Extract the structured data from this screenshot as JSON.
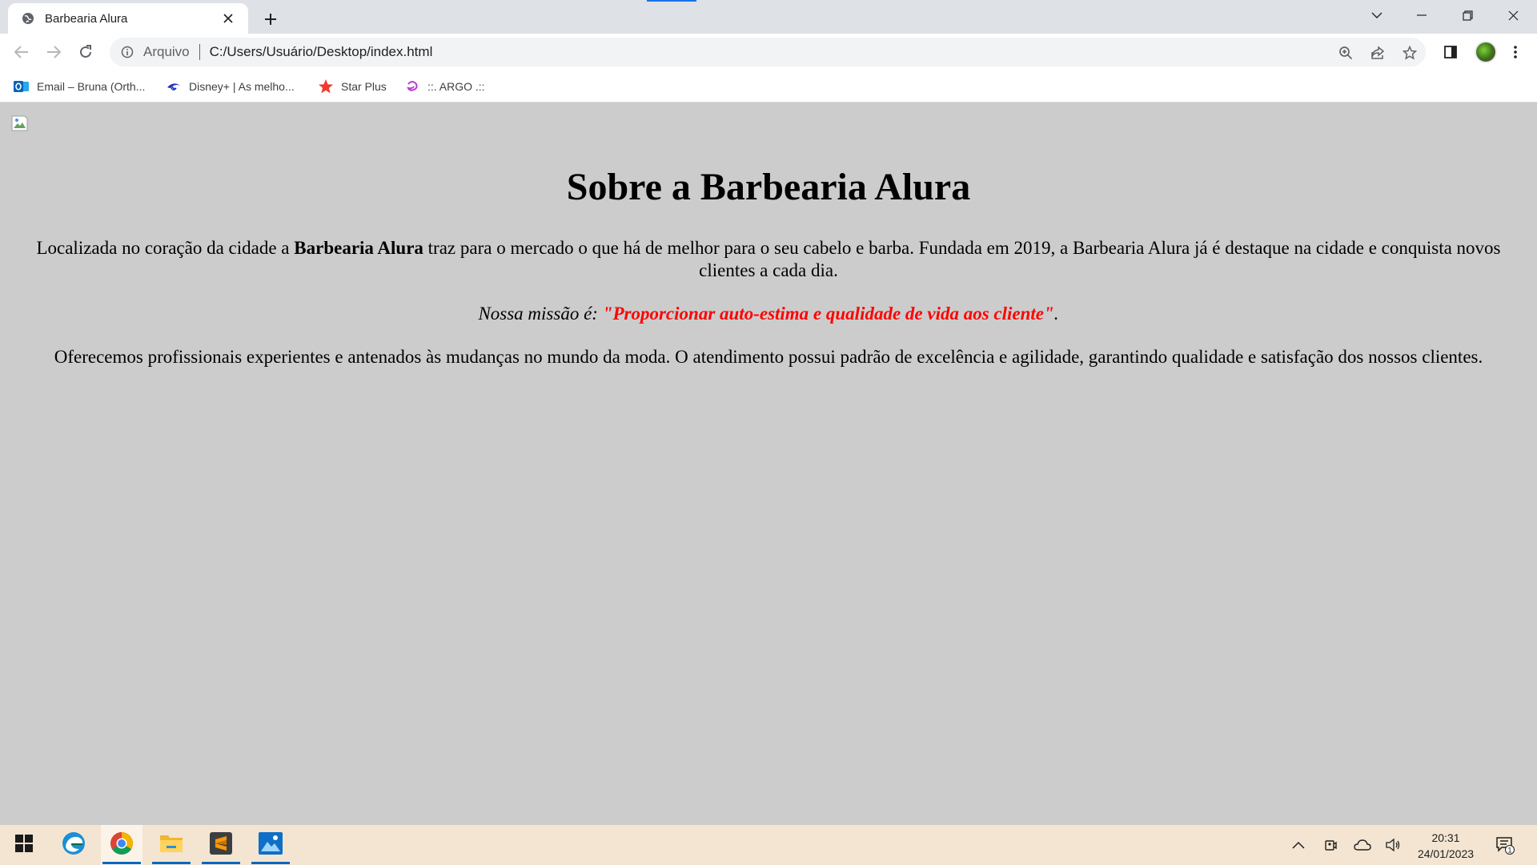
{
  "browser": {
    "tab": {
      "title": "Barbearia Alura",
      "favicon": "globe-icon"
    },
    "address_bar": {
      "scheme_label": "Arquivo",
      "url": "C:/Users/Usuário/Desktop/index.html"
    },
    "bookmarks": [
      {
        "label": "Email – Bruna (Orth...",
        "icon": "outlook-icon"
      },
      {
        "label": "Disney+ | As melho...",
        "icon": "disney-icon"
      },
      {
        "label": "Star Plus",
        "icon": "star-icon"
      },
      {
        "label": "::. ARGO .::",
        "icon": "argo-icon"
      }
    ]
  },
  "page": {
    "title": "Sobre a Barbearia Alura",
    "p1": {
      "before": "Localizada no coração da cidade a ",
      "bold": "Barbearia Alura",
      "after": " traz para o mercado o que há de melhor para o seu cabelo e barba. Fundada em 2019, a Barbearia Alura já é destaque na cidade e conquista novos clientes a cada dia."
    },
    "mission": {
      "label": "Nossa missão é: ",
      "quote": "\"Proporcionar auto-estima e qualidade de vida aos cliente\"",
      "end": ".",
      "quote_color": "#ff0000"
    },
    "p3": "Oferecemos profissionais experientes e antenados às mudanças no mundo da moda. O atendimento possui padrão de excelência e agilidade, garantindo qualidade e satisfação dos nossos clientes.",
    "background_color": "#cccccc"
  },
  "taskbar": {
    "apps": [
      "windows-start-icon",
      "edge-icon",
      "chrome-icon",
      "file-explorer-icon",
      "sublime-text-icon",
      "photos-icon"
    ],
    "active_app": "chrome-icon",
    "clock": {
      "time": "20:31",
      "date": "24/01/2023"
    },
    "notification_count": "1"
  }
}
